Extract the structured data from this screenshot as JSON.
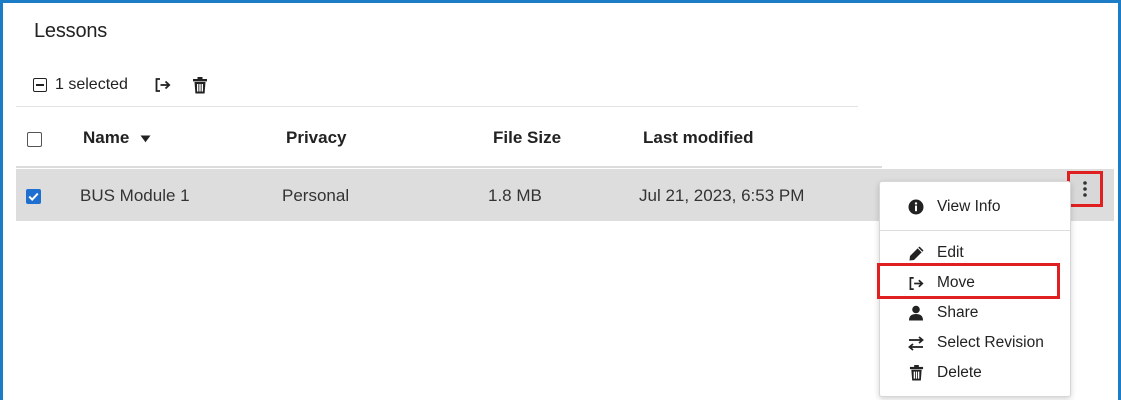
{
  "panel": {
    "title": "Lessons"
  },
  "toolbar": {
    "selected_text": "1 selected",
    "icons": [
      "deselect-icon",
      "move-icon",
      "delete-icon"
    ]
  },
  "table": {
    "columns": [
      "Name",
      "Privacy",
      "File Size",
      "Last modified"
    ],
    "sort_indicator": "caret-down-icon",
    "rows": [
      {
        "checked": true,
        "name": "BUS Module 1",
        "privacy": "Personal",
        "file_size": "1.8 MB",
        "last_modified": "Jul 21, 2023, 6:53 PM"
      }
    ]
  },
  "context_menu": {
    "items": [
      {
        "label": "View Info",
        "icon": "info-icon"
      },
      {
        "label": "Edit",
        "icon": "pencil-icon"
      },
      {
        "label": "Move",
        "icon": "move-icon"
      },
      {
        "label": "Share",
        "icon": "user-icon"
      },
      {
        "label": "Select Revision",
        "icon": "swap-icon"
      },
      {
        "label": "Delete",
        "icon": "trash-icon"
      }
    ]
  },
  "colors": {
    "frame_border": "#1d7cc6",
    "highlight_red": "#e02020",
    "checkbox_blue": "#1f6fd1",
    "selected_row": "#dddddd"
  }
}
